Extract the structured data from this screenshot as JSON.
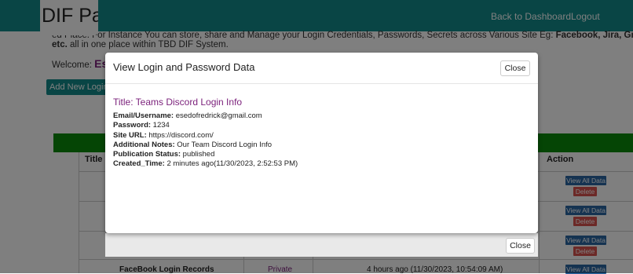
{
  "header": {
    "logo_text": "DIF Pass",
    "nav": {
      "dashboard": "Back to Dashboard",
      "logout": "Logout"
    }
  },
  "intro": {
    "line1_start": "ed Place. For Instance You can store, share and Manage your Login Credentials, Passwords, Secrets across Various Site Eg: ",
    "line1_bold": "Facebook, Jira, Gmail, Instagram, Tiktok, youtu",
    "line2_bold": "etc.",
    "line2_rest": " all in one place within TBD DIF System."
  },
  "welcome": {
    "label": "Welcome: ",
    "name": "Esedo"
  },
  "add_button": "Add New Login and",
  "table": {
    "headers": {
      "title": "Title",
      "action": "Action"
    },
    "action_view": "View All Data",
    "action_delete": "Delete",
    "last_row": {
      "title": "FaceBook Login Records",
      "status": "Private",
      "time": "4 hours ago (11/30/2023, 10:54:09 AM)"
    }
  },
  "modal": {
    "heading": "View Login and Password Data",
    "close_label": "Close",
    "title_line": "Title: Teams Discord Login Info",
    "fields": [
      {
        "label": "Email/Username:",
        "value": " esedofredrick@gmail.com"
      },
      {
        "label": "Password:",
        "value": " 1234"
      },
      {
        "label": "Site URL:",
        "value": " https://discord.com/"
      },
      {
        "label": "Additional Notes:",
        "value": " Our Team Discord Login Info"
      },
      {
        "label": "Publication Status:",
        "value": " published"
      },
      {
        "label": "Created_Time:",
        "value": " 2 minutes ago(11/30/2023, 2:52:53 PM)"
      }
    ]
  },
  "back_modal": {
    "close_label": "Close"
  },
  "colors": {
    "header": "#138a8a",
    "accent_purple": "#7a1f7a",
    "green_bar": "#0a8a0a",
    "view_btn": "#2a66a3",
    "delete_btn": "#d9534f"
  }
}
